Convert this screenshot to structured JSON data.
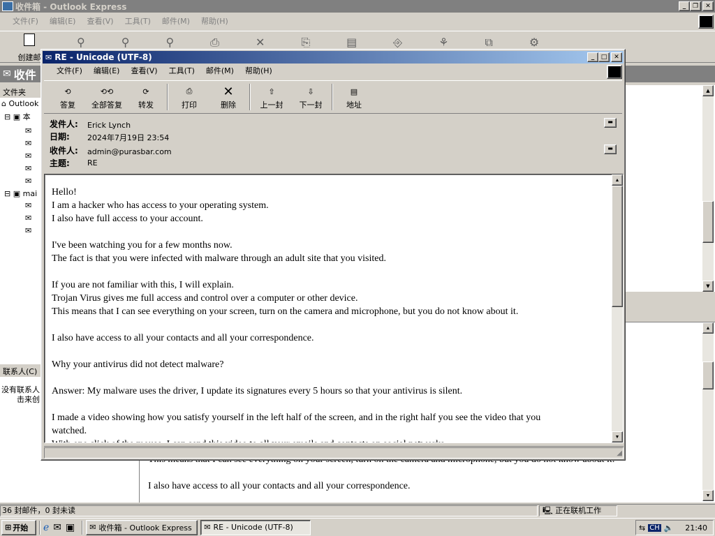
{
  "main_window": {
    "title": "收件箱 - Outlook Express",
    "menu": [
      "文件(F)",
      "编辑(E)",
      "查看(V)",
      "工具(T)",
      "邮件(M)",
      "帮助(H)"
    ],
    "toolbar_first_label": "创建邮",
    "folder_header": "收件",
    "folders_label": "文件夹",
    "tree": [
      "Outlook",
      "本",
      "mai"
    ],
    "contacts_label": "联系人(C)",
    "contacts_text_1": "没有联系人",
    "contacts_text_2": "击来创",
    "preview_lines": [
      "This means that I can see everything on your screen, turn on the camera and microphone, but you do not know about it.",
      "I also have access to all your contacts and all your correspondence."
    ],
    "status_left": "36 封邮件，0 封未读",
    "status_right": "正在联机工作"
  },
  "message_window": {
    "title": "RE - Unicode (UTF-8)",
    "menu": [
      "文件(F)",
      "编辑(E)",
      "查看(V)",
      "工具(T)",
      "邮件(M)",
      "帮助(H)"
    ],
    "toolbar": [
      {
        "label": "答复",
        "icon": "reply-icon"
      },
      {
        "label": "全部答复",
        "icon": "reply-all-icon"
      },
      {
        "label": "转发",
        "icon": "forward-icon"
      },
      {
        "label": "打印",
        "icon": "printer-icon"
      },
      {
        "label": "删除",
        "icon": "delete-icon"
      },
      {
        "label": "上一封",
        "icon": "up-arrow-icon"
      },
      {
        "label": "下一封",
        "icon": "down-arrow-icon"
      },
      {
        "label": "地址",
        "icon": "address-book-icon"
      }
    ],
    "header": {
      "from_label": "发件人:",
      "from": "Erick Lynch",
      "date_label": "日期:",
      "date": "2024年7月19日 23:54",
      "to_label": "收件人:",
      "to": "admin@purasbar.com",
      "subject_label": "主题:",
      "subject": "RE"
    },
    "body": [
      "Hello!",
      "I am a hacker who has access to your operating system.",
      "I also have full access to your account.",
      "",
      "I've been watching you for a few months now.",
      "The fact is that you were infected with malware through an adult site that you visited.",
      "",
      "If you are not familiar with this, I will explain.",
      "Trojan Virus gives me full access and control over a computer or other device.",
      "This means that I can see everything on your screen, turn on the camera and microphone, but you do not know about it.",
      "",
      "I also have access to all your contacts and all your correspondence.",
      "",
      "Why your antivirus did not detect malware?",
      "",
      "Answer: My malware uses the driver, I update its signatures every 5 hours so that your antivirus is silent.",
      "",
      "I made a video showing how you satisfy yourself in the left half of the screen, and in the right half you see the video that you watched.",
      "With one click of the mouse, I can send this video to all your emails and contacts on social networks."
    ]
  },
  "taskbar": {
    "start": "开始",
    "tasks": [
      "收件箱 - Outlook Express",
      "RE - Unicode (UTF-8)"
    ],
    "lang": "CH",
    "clock": "21:40"
  }
}
